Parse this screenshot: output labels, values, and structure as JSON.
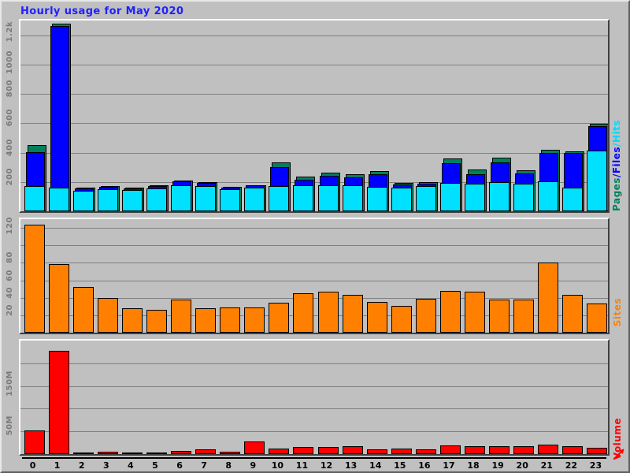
{
  "title": "Hourly usage for May 2020",
  "axes": {
    "x_label_prefix": "hour",
    "hours": [
      "0",
      "1",
      "2",
      "3",
      "4",
      "5",
      "6",
      "7",
      "8",
      "9",
      "10",
      "11",
      "12",
      "13",
      "14",
      "15",
      "16",
      "17",
      "18",
      "19",
      "20",
      "21",
      "22",
      "23"
    ]
  },
  "side_labels": {
    "pages": "Pages",
    "slash1": "/",
    "files": "Files",
    "slash2": "/",
    "hits": "Hits",
    "sites": "Sites",
    "volume": "Volume"
  },
  "colors": {
    "pages": "#00805c",
    "files": "#0000ff",
    "hits": "#00e0ff",
    "sites": "#ff8000",
    "volume": "#ff0000",
    "title": "#2020ff",
    "background": "#c0c0c0",
    "gridline": "#808080",
    "axis_text": "#7a7a7a"
  },
  "panels": {
    "top": {
      "name": "pages-files-hits",
      "ytick_labels": [
        "200",
        "400",
        "600",
        "800",
        "1000",
        "1.2k"
      ],
      "ytick_values": [
        200,
        400,
        600,
        800,
        1000,
        1200
      ]
    },
    "middle": {
      "name": "sites",
      "ytick_labels": [
        "20",
        "40",
        "60",
        "80",
        "",
        "120"
      ],
      "ytick_values": [
        20,
        40,
        60,
        80,
        100,
        120
      ]
    },
    "bottom": {
      "name": "volume",
      "ytick_labels": [
        "50M",
        "",
        "150M",
        ""
      ],
      "ytick_values": [
        50,
        100,
        150,
        200
      ]
    }
  },
  "chart_data": [
    {
      "type": "bar",
      "id": "pages-files-hits",
      "title": "Hourly usage for May 2020",
      "xlabel": "",
      "ylabel": "Pages/Files/Hits",
      "categories": [
        "0",
        "1",
        "2",
        "3",
        "4",
        "5",
        "6",
        "7",
        "8",
        "9",
        "10",
        "11",
        "12",
        "13",
        "14",
        "15",
        "16",
        "17",
        "18",
        "19",
        "20",
        "21",
        "22",
        "23"
      ],
      "ylim": [
        0,
        1300
      ],
      "yticks": [
        200,
        400,
        600,
        800,
        1000,
        1200
      ],
      "ytick_labels": [
        "200",
        "400",
        "600",
        "800",
        "1000",
        "1.2k"
      ],
      "grid": true,
      "stacked": true,
      "legend": "right-vertical",
      "series": [
        {
          "name": "Hits",
          "color": "#00e0ff",
          "values": [
            170,
            160,
            140,
            150,
            145,
            155,
            180,
            170,
            150,
            160,
            170,
            175,
            180,
            175,
            165,
            160,
            170,
            195,
            190,
            200,
            190,
            205,
            160,
            415
          ]
        },
        {
          "name": "Files",
          "color": "#0000ff",
          "values": [
            405,
            1265,
            155,
            165,
            158,
            170,
            205,
            195,
            160,
            175,
            300,
            215,
            240,
            230,
            250,
            185,
            190,
            330,
            255,
            335,
            260,
            400,
            400,
            580
          ]
        },
        {
          "name": "Pages",
          "color": "#00805c",
          "values": [
            450,
            1280,
            160,
            172,
            162,
            175,
            212,
            200,
            165,
            180,
            335,
            235,
            265,
            255,
            275,
            195,
            200,
            360,
            285,
            365,
            282,
            420,
            410,
            595
          ]
        }
      ]
    },
    {
      "type": "bar",
      "id": "sites",
      "ylabel": "Sites",
      "categories": [
        "0",
        "1",
        "2",
        "3",
        "4",
        "5",
        "6",
        "7",
        "8",
        "9",
        "10",
        "11",
        "12",
        "13",
        "14",
        "15",
        "16",
        "17",
        "18",
        "19",
        "20",
        "21",
        "22",
        "23"
      ],
      "values": [
        124,
        79,
        52,
        40,
        28,
        26,
        38,
        28,
        29,
        29,
        34,
        45,
        47,
        43,
        35,
        31,
        39,
        48,
        47,
        38,
        38,
        80,
        43,
        33
      ],
      "ylim": [
        0,
        130
      ],
      "yticks": [
        20,
        40,
        60,
        80,
        100,
        120
      ],
      "ytick_labels": [
        "20",
        "40",
        "60",
        "80",
        "",
        "120"
      ],
      "grid": true,
      "color": "#ff8000"
    },
    {
      "type": "bar",
      "id": "volume",
      "ylabel": "Volume",
      "categories": [
        "0",
        "1",
        "2",
        "3",
        "4",
        "5",
        "6",
        "7",
        "8",
        "9",
        "10",
        "11",
        "12",
        "13",
        "14",
        "15",
        "16",
        "17",
        "18",
        "19",
        "20",
        "21",
        "22",
        "23"
      ],
      "values": [
        52,
        228,
        3,
        5,
        3,
        3,
        7,
        10,
        5,
        28,
        13,
        16,
        16,
        17,
        10,
        12,
        10,
        19,
        17,
        17,
        18,
        20,
        17,
        14
      ],
      "ylim": [
        0,
        250
      ],
      "yticks": [
        50,
        100,
        150,
        200
      ],
      "ytick_labels": [
        "50M",
        "",
        "150M",
        ""
      ],
      "grid": true,
      "color": "#ff0000",
      "unit": "M"
    }
  ]
}
